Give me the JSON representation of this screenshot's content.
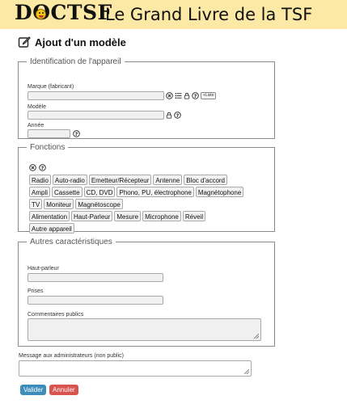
{
  "header": {
    "logo_pre": "D",
    "logo_o": "O",
    "logo_post": "CTSF",
    "site_title": "Le Grand Livre de la TSF",
    "bg": "#fde9a6"
  },
  "page_title": "Ajout d'un modèle",
  "ident": {
    "legend": "Identification de l'appareil",
    "marque_label": "Marque (fabricant)",
    "marque_value": "",
    "add_label": "+Liste",
    "modele_label": "Modèle",
    "modele_value": "",
    "annee_label": "Année",
    "annee_value": ""
  },
  "fonctions": {
    "legend": "Fonctions",
    "rows": [
      [
        "Radio",
        "Auto-radio",
        "Emetteur/Récepteur",
        "Antenne",
        "Bloc d'accord"
      ],
      [
        "Ampli",
        "Cassette",
        "CD, DVD",
        "Phono, PU, électrophone",
        "Magnétophone"
      ],
      [
        "TV",
        "Moniteur",
        "Magnétoscope"
      ],
      [
        "Alimentation",
        "Haut-Parleur",
        "Mesure",
        "Microphone",
        "Réveil"
      ],
      [
        "Autre appareil"
      ]
    ]
  },
  "autres": {
    "legend": "Autres caractéristiques",
    "hp_label": "Haut-parleur",
    "prises_label": "Prises",
    "comments_label": "Commentaires publics"
  },
  "admin_label": "Message aux administrateurs (non public)",
  "buttons": {
    "validate": "Valider",
    "cancel": "Annuler"
  },
  "icons": {
    "clear": "circle-x-icon",
    "list": "list-icon",
    "lock": "lock-icon",
    "help": "help-icon",
    "edit": "edit-icon"
  }
}
